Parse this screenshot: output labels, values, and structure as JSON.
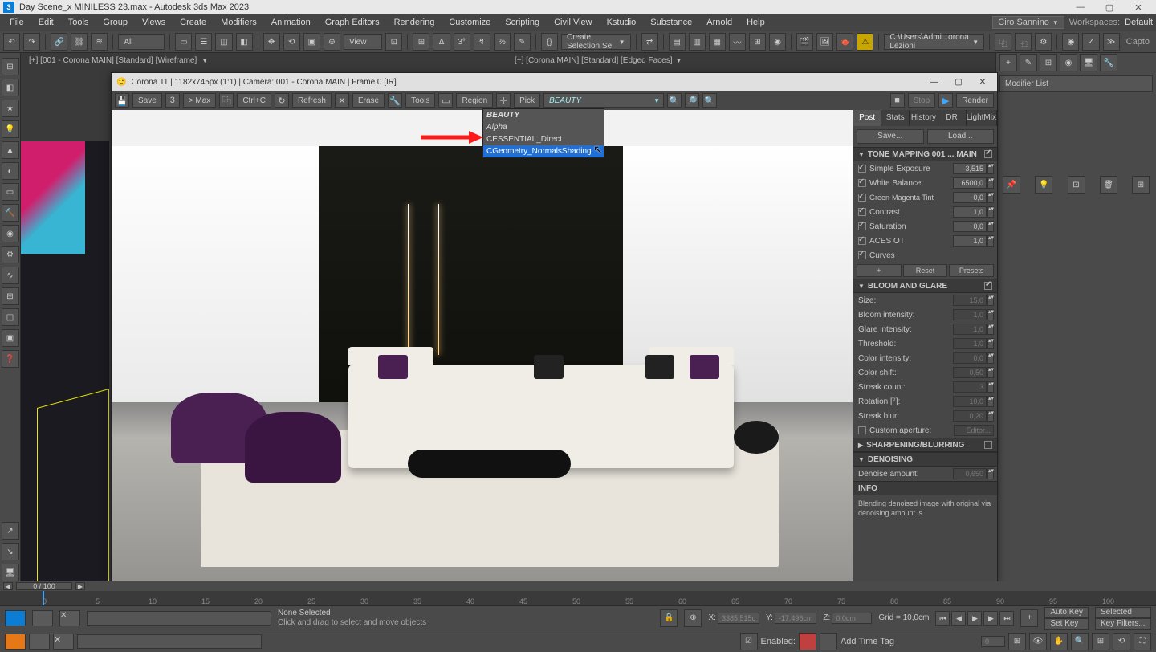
{
  "titlebar": {
    "icon": "3",
    "filename": "Day Scene_x MINILESS 23.max - Autodesk 3ds Max 2023"
  },
  "menubar": {
    "items": [
      "File",
      "Edit",
      "Tools",
      "Group",
      "Views",
      "Create",
      "Modifiers",
      "Animation",
      "Graph Editors",
      "Rendering",
      "Customize",
      "Scripting",
      "Civil View",
      "Kstudio",
      "Substance",
      "Arnold",
      "Help"
    ],
    "user": "Ciro Sannino",
    "workspaces_label": "Workspaces:",
    "workspaces_value": "Default"
  },
  "toolbar": {
    "filter": "All",
    "view": "View",
    "selset": "Create Selection Se",
    "path": "C:\\Users\\Admi...orona Lezioni",
    "capto": "Capto"
  },
  "viewports": {
    "left_label": "[+] [001 - Corona MAIN] [Standard] [Wireframe]",
    "right_label": "[+] [Corona MAIN] [Standard] [Edged Faces]"
  },
  "rightpanel": {
    "modifier_list": "Modifier List"
  },
  "vfb": {
    "title": "Corona 11 | 1182x745px (1:1) | Camera: 001 - Corona MAIN | Frame 0 [IR]",
    "buttons": {
      "save": "Save",
      "tomax": "> Max",
      "ctrlc": "Ctrl+C",
      "refresh": "Refresh",
      "erase": "Erase",
      "tools": "Tools",
      "region": "Region",
      "pick": "Pick"
    },
    "dropdown": {
      "current": "BEAUTY",
      "items": [
        "BEAUTY",
        "Alpha",
        "CESSENTIAL_Direct",
        "CGeometry_NormalsShading"
      ]
    },
    "render_btn": {
      "stop": "Stop",
      "render": "Render"
    },
    "side": {
      "tabs": [
        "Post",
        "Stats",
        "History",
        "DR",
        "LightMix"
      ],
      "save": "Save...",
      "load": "Load...",
      "sections": {
        "tone": {
          "title": "TONE MAPPING  001 ... MAIN",
          "rows": [
            {
              "label": "Simple Exposure",
              "value": "3,515",
              "checked": true
            },
            {
              "label": "White Balance",
              "value": "6500,0",
              "checked": true
            },
            {
              "label": "Green-Magenta Tint",
              "value": "0,0",
              "checked": true
            },
            {
              "label": "Contrast",
              "value": "1,0",
              "checked": true
            },
            {
              "label": "Saturation",
              "value": "0,0",
              "checked": true
            },
            {
              "label": "ACES OT",
              "value": "1,0",
              "checked": true
            },
            {
              "label": "Curves",
              "value": "",
              "checked": true
            }
          ],
          "add": "+",
          "reset": "Reset",
          "presets": "Presets"
        },
        "bloom": {
          "title": "BLOOM AND GLARE",
          "rows": [
            {
              "label": "Size:",
              "value": "15,0"
            },
            {
              "label": "Bloom intensity:",
              "value": "1,0"
            },
            {
              "label": "Glare intensity:",
              "value": "1,0"
            },
            {
              "label": "Threshold:",
              "value": "1,0"
            },
            {
              "label": "Color intensity:",
              "value": "0,0"
            },
            {
              "label": "Color shift:",
              "value": "0,50"
            },
            {
              "label": "Streak count:",
              "value": "3"
            },
            {
              "label": "Rotation [°]:",
              "value": "10,0"
            },
            {
              "label": "Streak blur:",
              "value": "0,20"
            }
          ],
          "custom_aperture": "Custom aperture:",
          "editor": "Editor..."
        },
        "sharpen": {
          "title": "SHARPENING/BLURRING"
        },
        "denoise": {
          "title": "DENOISING",
          "amount_label": "Denoise amount:",
          "amount_value": "0,650"
        },
        "info": {
          "title": "INFO",
          "text": "Blending denoised image with original via denoising amount is"
        }
      }
    }
  },
  "timeline": {
    "frame_display": "0 / 100",
    "ticks": [
      "0",
      "5",
      "10",
      "15",
      "20",
      "25",
      "30",
      "35",
      "40",
      "45",
      "50",
      "55",
      "60",
      "65",
      "70",
      "75",
      "80",
      "85",
      "90",
      "95",
      "100"
    ]
  },
  "statusbar": {
    "selected": "None Selected",
    "prompt": "Click and drag to select and move objects",
    "x": "X:",
    "xv": "3385,515c",
    "y": "Y:",
    "yv": "-17,496cm",
    "z": "Z:",
    "zv": "0,0cm",
    "grid": "Grid = 10,0cm",
    "autokey": "Auto Key",
    "setkey": "Set Key",
    "selected2": "Selected",
    "keyfilters": "Key Filters...",
    "enabled": "Enabled:",
    "addtimetag": "Add Time Tag"
  }
}
